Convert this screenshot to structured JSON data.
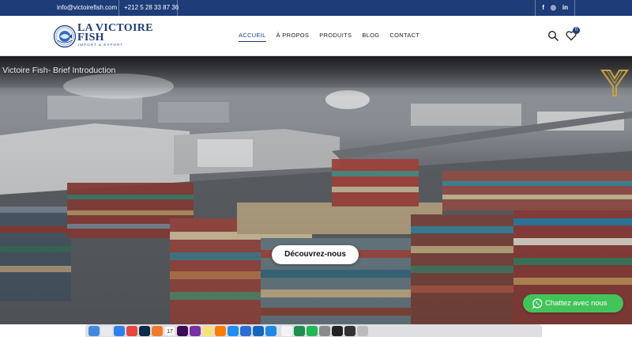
{
  "topbar": {
    "email": "info@victoirefish.com",
    "phone": "+212 5 28 33 87 36",
    "socials": [
      {
        "icon": "facebook-icon",
        "glyph": "f"
      },
      {
        "icon": "instagram-icon",
        "glyph": "◎"
      },
      {
        "icon": "linkedin-icon",
        "glyph": "in"
      }
    ]
  },
  "header": {
    "logo": {
      "name_line1": "LA VICTOIRE",
      "name_line2": "FISH",
      "tagline": "IMPORT & EXPORT"
    },
    "nav": [
      {
        "label": "ACCUEIL",
        "active": true
      },
      {
        "label": "À PROPOS",
        "active": false
      },
      {
        "label": "PRODUITS",
        "active": false
      },
      {
        "label": "BLOG",
        "active": false
      },
      {
        "label": "CONTACT",
        "active": false
      }
    ],
    "wishlist_count": "0"
  },
  "hero": {
    "video_title": "Victoire Fish- Brief Introduction",
    "cta_label": "Découvrez-nous"
  },
  "chat": {
    "label": "Chattez avec nous"
  },
  "colors": {
    "brand": "#1d3c78",
    "whatsapp": "#41c45a"
  },
  "dock": {
    "apps": [
      "finder-icon",
      "launchpad-icon",
      "safari-icon",
      "chrome-icon",
      "photoshop-icon",
      "firefox-icon",
      "calendar-icon",
      "premiere-icon",
      "onenote-icon",
      "notes-icon",
      "illustrator-icon",
      "appstore-icon",
      "vpn-icon",
      "outlook-icon",
      "vscode-icon",
      "textedit-icon",
      "excel-icon",
      "spotify-icon",
      "settings-icon",
      "terminal-icon",
      "activity-icon",
      "trash-icon"
    ],
    "calendar_day": "17"
  }
}
